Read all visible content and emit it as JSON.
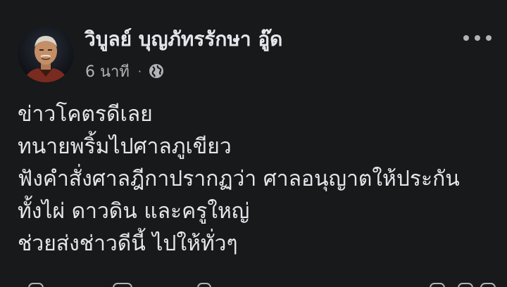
{
  "post": {
    "author_name": "วิบูลย์ บุญภัทรรักษา อู๊ด",
    "timestamp": "6 นาที",
    "separator": "·",
    "privacy_icon": "globe-icon",
    "more_icon": "more-horizontal-icon",
    "lines": [
      "ข่าวโคตรดีเลย",
      "ทนายพริ้มไปศาลภูเขียว",
      "ฟังคำสั่งศาลฎีกาปรากฏว่า ศาลอนุญาตให้ประกัน",
      "ทั้งไผ่ ดาวดิน และครูใหญ่",
      "ช่วยส่งช่าวดีนี้ ไปให้ทั่วๆ"
    ]
  },
  "colors": {
    "background": "#18191a",
    "primary_text": "#e4e6eb",
    "secondary_text": "#b0b3b8"
  }
}
